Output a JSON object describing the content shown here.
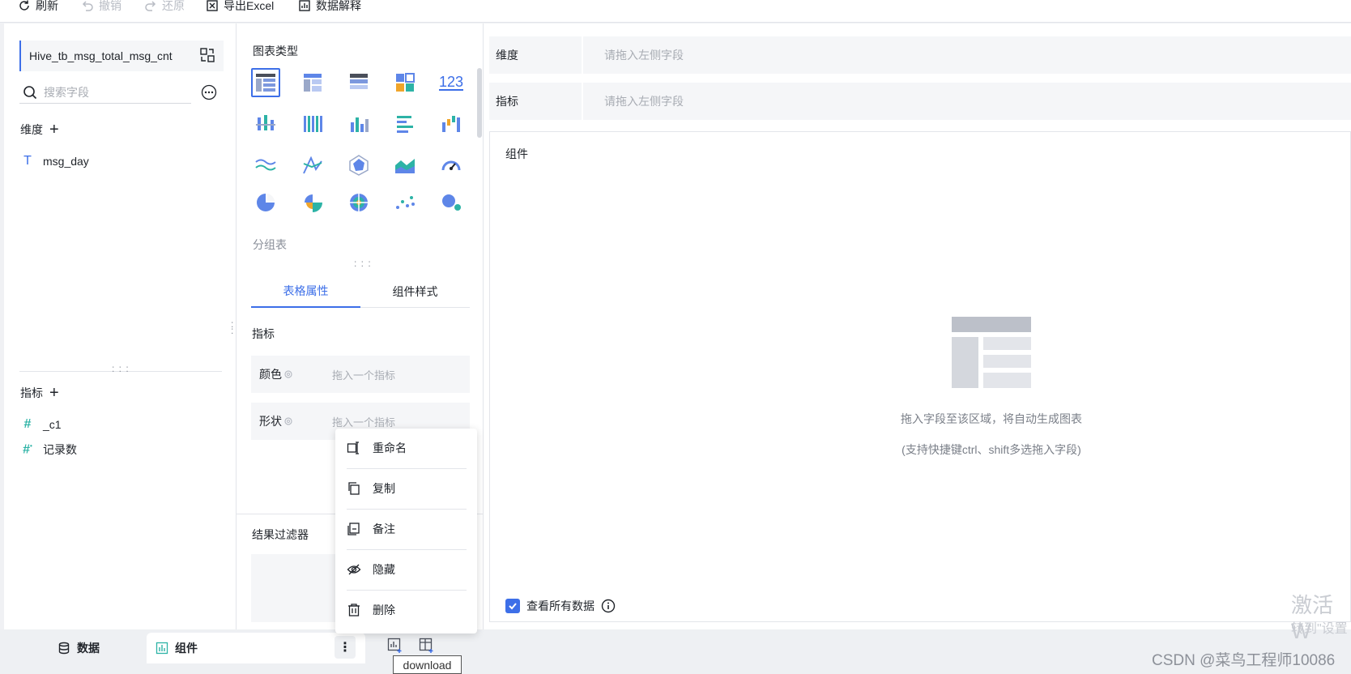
{
  "toolbar": {
    "refresh": "刷新",
    "undo": "撤销",
    "redo": "还原",
    "export_excel": "导出Excel",
    "data_explain": "数据解释"
  },
  "left": {
    "dataset_name": "Hive_tb_msg_total_msg_cnt",
    "search_placeholder": "搜索字段",
    "dimensions_title": "维度",
    "dimension_fields": [
      {
        "type_icon": "text-type-icon",
        "name": "msg_day"
      }
    ],
    "metrics_title": "指标",
    "metric_fields": [
      {
        "type_icon": "number-type-icon",
        "name": "_c1"
      },
      {
        "type_icon": "record-count-icon",
        "name": "记录数"
      }
    ]
  },
  "middle": {
    "chart_type_title": "图表类型",
    "chart_type_123": "123",
    "selected_chart_name": "分组表",
    "tabs": [
      {
        "label": "表格属性",
        "active": true
      },
      {
        "label": "组件样式",
        "active": false
      }
    ],
    "metrics_section": "指标",
    "color_label": "颜色",
    "color_placeholder": "拖入一个指标",
    "shape_label": "形状",
    "shape_placeholder": "拖入一个指标",
    "result_filter": "结果过滤器"
  },
  "right": {
    "dimension_label": "维度",
    "dimension_placeholder": "请拖入左侧字段",
    "metric_label": "指标",
    "metric_placeholder": "请拖入左侧字段",
    "canvas_title": "组件",
    "empty_hint_1": "拖入字段至该区域，将自动生成图表",
    "empty_hint_2": "(支持快捷键ctrl、shift多选拖入字段)",
    "view_all_data": "查看所有数据",
    "view_all_checked": true
  },
  "context_menu": {
    "items": [
      {
        "icon": "rename-icon",
        "label": "重命名"
      },
      {
        "icon": "copy-icon",
        "label": "复制"
      },
      {
        "icon": "note-icon",
        "label": "备注"
      },
      {
        "icon": "hide-icon",
        "label": "隐藏"
      },
      {
        "icon": "delete-icon",
        "label": "删除"
      }
    ]
  },
  "bottom": {
    "data_tab": "数据",
    "component_tab": "组件",
    "tooltip": "download"
  },
  "overlay": {
    "activate_line1": "激活 W",
    "activate_line2": "转到\"设置",
    "watermark": "CSDN @菜鸟工程师10086"
  },
  "colors": {
    "accent": "#3d6fe8",
    "teal": "#2db3a6",
    "panel_bg": "#f5f6f8"
  }
}
